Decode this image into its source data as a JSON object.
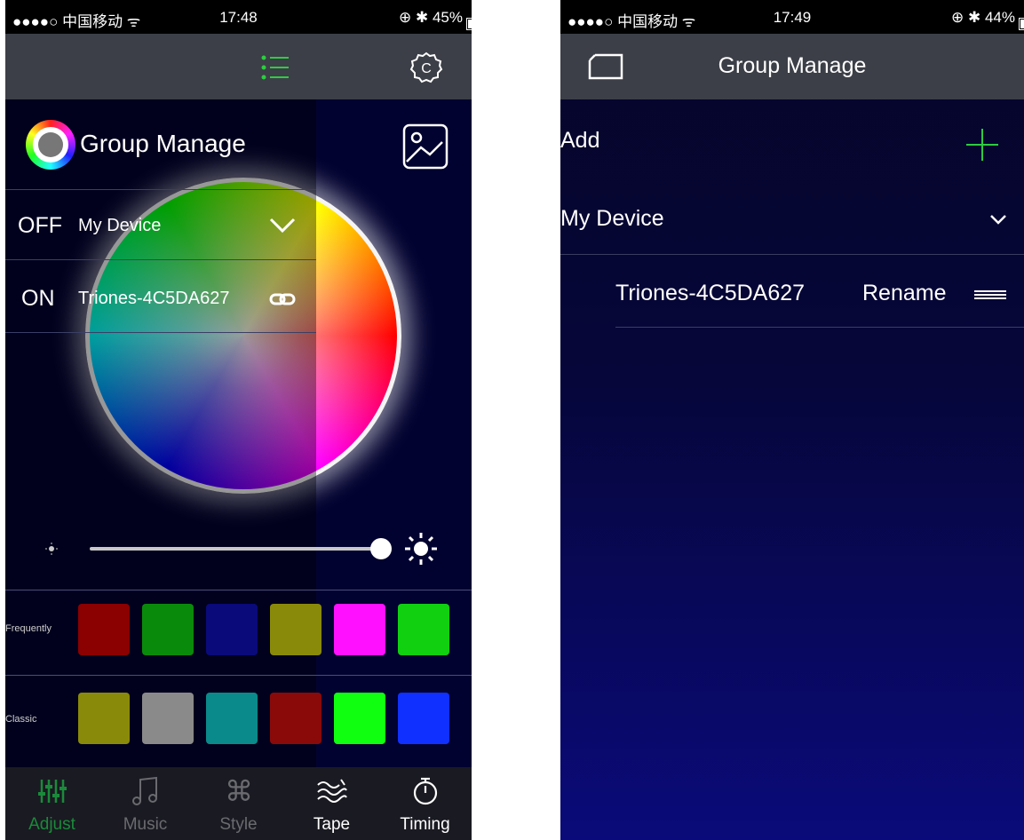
{
  "left": {
    "status": {
      "carrier": "●●●●○ 中国移动 ᯤ",
      "time": "17:48",
      "right": "⊕ ✱ 45%",
      "battery_level": 0.45
    },
    "header": {
      "title": "Group Manage"
    },
    "devices": [
      {
        "state": "OFF",
        "name": "My Device"
      },
      {
        "state": "ON",
        "name": "Triones-4C5DA627"
      }
    ],
    "brightness": 0.98,
    "frequently": {
      "label": "Frequently",
      "colors": [
        "#8b0000",
        "#0a8a0a",
        "#0a0a7a",
        "#8a8a0a",
        "#ff10ff",
        "#10d010"
      ]
    },
    "classic": {
      "label": "Classic",
      "colors": [
        "#8a8a0a",
        "#8a8a8a",
        "#0a8a8a",
        "#8a0a0a",
        "#10ff10",
        "#1030ff"
      ]
    },
    "tabs": [
      {
        "label": "Adjust",
        "icon": "equalizer-icon",
        "color": "#1a8a3a"
      },
      {
        "label": "Music",
        "icon": "music-note-icon",
        "color": "#6a6a70"
      },
      {
        "label": "Style",
        "icon": "command-icon",
        "color": "#6a6a70"
      },
      {
        "label": "Tape",
        "icon": "wave-icon",
        "color": "#ffffff"
      },
      {
        "label": "Timing",
        "icon": "stopwatch-icon",
        "color": "#ffffff"
      }
    ]
  },
  "right": {
    "status": {
      "carrier": "●●●●○ 中国移动 ᯤ",
      "time": "17:49",
      "right": "⊕ ✱ 44%",
      "battery_level": 0.44
    },
    "nav": {
      "title": "Group Manage"
    },
    "add_label": "Add",
    "group_name": "My Device",
    "device": {
      "name": "Triones-4C5DA627",
      "rename_label": "Rename"
    }
  },
  "accent": "#2ecc40"
}
